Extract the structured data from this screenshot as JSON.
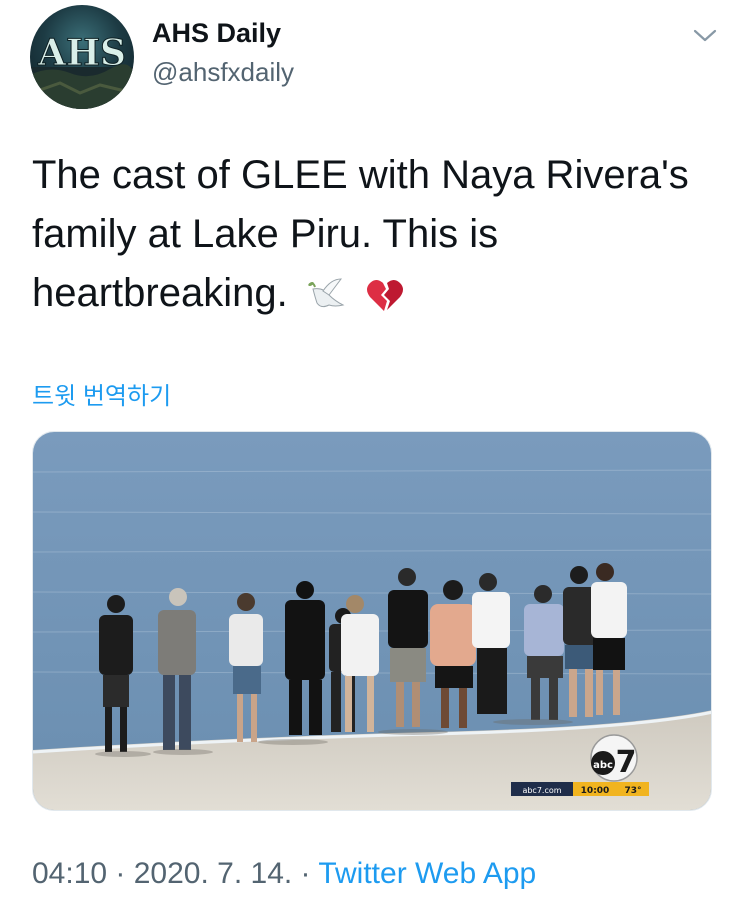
{
  "tweet": {
    "author": {
      "display_name": "AHS Daily",
      "handle": "@ahsfxdaily",
      "avatar_logo": "AHS",
      "avatar_icon": "profile-avatar"
    },
    "menu_icon": "chevron-down-icon",
    "text_line1": "The cast of GLEE with Naya Rivera's",
    "text_line2": "family at Lake Piru. This is",
    "text_line3": "heartbreaking.",
    "emojis": [
      "dove-emoji",
      "broken-heart-emoji"
    ],
    "translate_label": "트윗 번역하기",
    "media": {
      "description_icon": "news-video-still",
      "station_logo": "abc",
      "station_number": "7",
      "ticker_site": "abc7.com",
      "ticker_time": "10:00",
      "ticker_temp": "73°"
    },
    "time": "04:10",
    "sep1": " · ",
    "date": "2020. 7. 14.",
    "sep2": " · ",
    "source": "Twitter Web App"
  },
  "colors": {
    "link": "#1d9bf0",
    "secondary_text": "#536471",
    "lake": "#6f93b6",
    "shore": "#d9d5cc"
  }
}
